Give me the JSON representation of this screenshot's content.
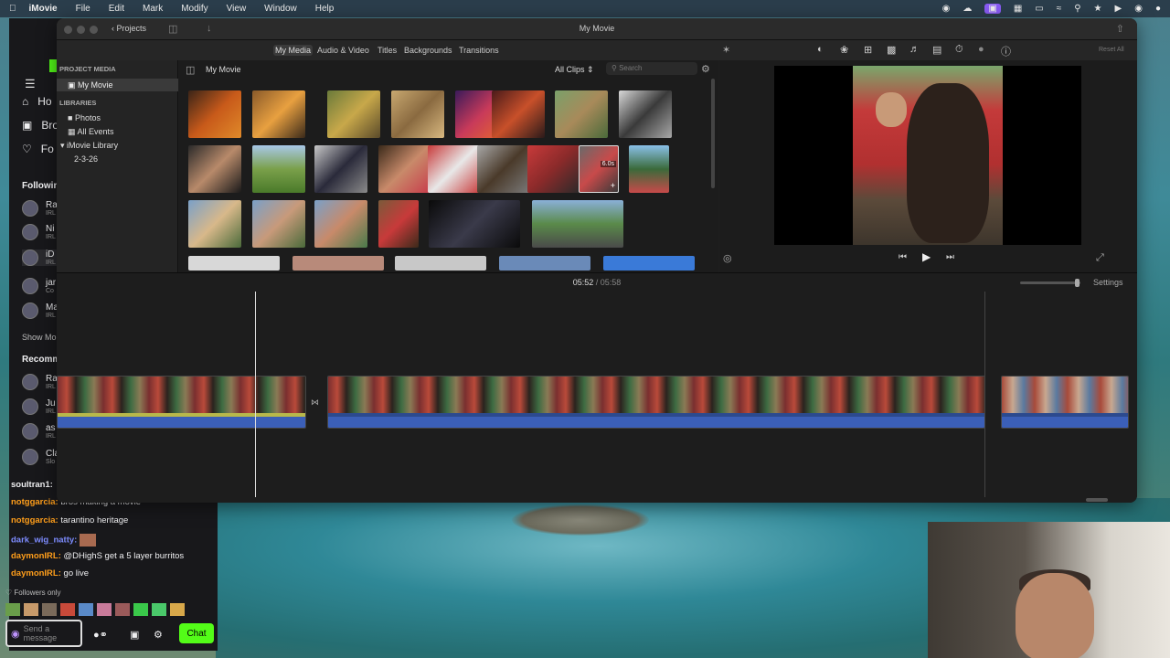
{
  "menubar": {
    "app": "iMovie",
    "items": [
      "File",
      "Edit",
      "Mark",
      "Modify",
      "View",
      "Window",
      "Help"
    ]
  },
  "twitch": {
    "nav": [
      "Ho",
      "Bro",
      "Fo"
    ],
    "following_label": "Following",
    "show_more": "Show Mo",
    "recommended_label": "Recomm",
    "channels": [
      {
        "name": "Ra",
        "sub": "IRL"
      },
      {
        "name": "Ni",
        "sub": "IRL"
      },
      {
        "name": "iD",
        "sub": "IRL"
      },
      {
        "name": "jar",
        "sub": "Co"
      },
      {
        "name": "Ma",
        "sub": "IRL"
      }
    ],
    "rec_channels": [
      {
        "name": "Ra",
        "sub": "IRL"
      },
      {
        "name": "Ju",
        "sub": "IRL"
      },
      {
        "name": "as",
        "sub": "IRL"
      },
      {
        "name": "Cla",
        "sub": "Slo"
      }
    ],
    "chat": [
      {
        "user": "soultran1:",
        "msg": "",
        "color": "#efeff1"
      },
      {
        "user": "notggarcia:",
        "msg": "bros making a movie",
        "color": "#ff9e1b"
      },
      {
        "user": "notggarcia:",
        "msg": "tarantino heritage",
        "color": "#ff9e1b"
      },
      {
        "user": "dark_wig_natty:",
        "msg": "",
        "color": "#7d8cff"
      },
      {
        "user": "daymonIRL:",
        "msg": "@DHighS get a 5 layer burritos",
        "color": "#ff9e1b"
      },
      {
        "user": "daymonIRL:",
        "msg": "go live",
        "color": "#ff9e1b"
      }
    ],
    "followers_only": "Followers only",
    "send_placeholder": "Send a message",
    "chat_button": "Chat"
  },
  "imovie": {
    "back": "Projects",
    "window_title": "My Movie",
    "tabs": [
      "My Media",
      "Audio & Video",
      "Titles",
      "Backgrounds",
      "Transitions"
    ],
    "reset_all": "Reset All",
    "sidebar": {
      "project_media": "PROJECT MEDIA",
      "project": "My Movie",
      "libraries": "LIBRARIES",
      "photos": "Photos",
      "all_events": "All Events",
      "library": "iMovie Library",
      "event": "2-3-26"
    },
    "browser": {
      "title": "My Movie",
      "filter": "All Clips",
      "search_placeholder": "Search",
      "clip_duration": "6.0s"
    },
    "timeline": {
      "current": "05:52",
      "separator": "/",
      "total": "05:58",
      "settings": "Settings"
    }
  }
}
